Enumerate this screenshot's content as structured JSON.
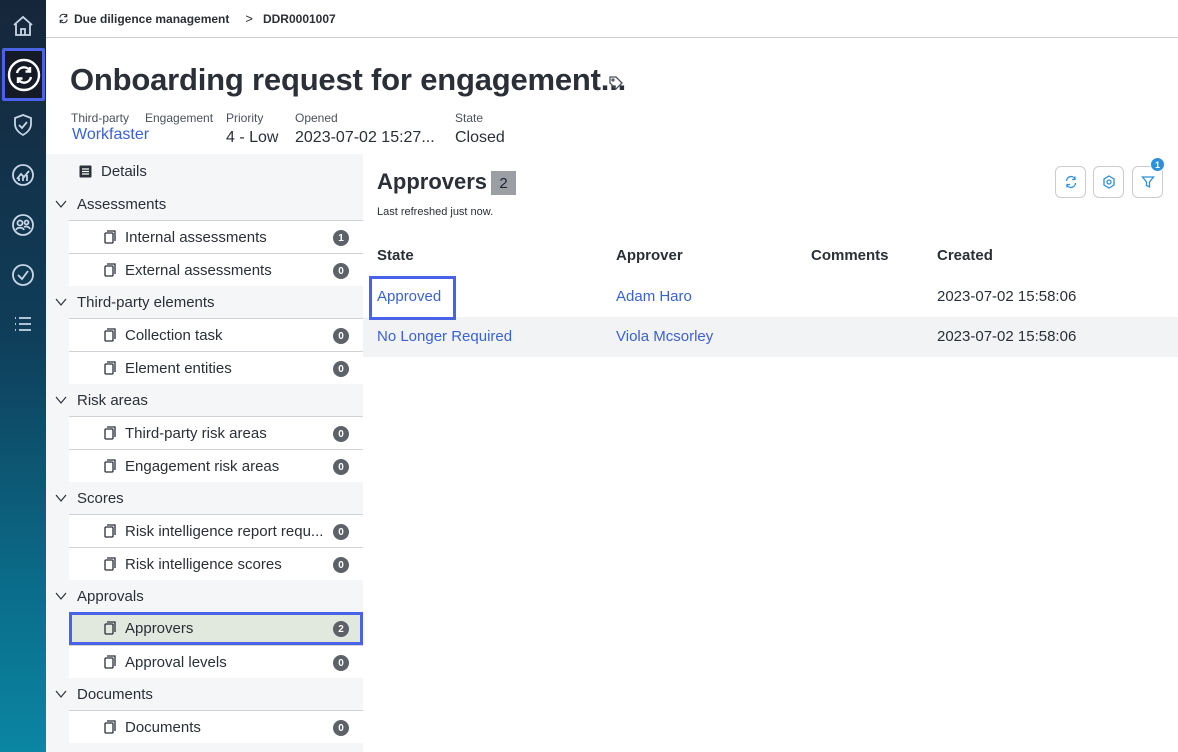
{
  "breadcrumb": {
    "module": "Due diligence management",
    "separator": ">",
    "record": "DDR0001007"
  },
  "header": {
    "title": "Onboarding request for engagement...",
    "fields": [
      {
        "label": "Third-party",
        "value": "Workfaster",
        "is_link": true
      },
      {
        "label": "Engagement",
        "value": ""
      },
      {
        "label": "Priority",
        "value": "4 - Low"
      },
      {
        "label": "Opened",
        "value": "2023-07-02 15:27..."
      },
      {
        "label": "State",
        "value": "Closed"
      }
    ]
  },
  "rail": {
    "items": [
      "home-icon",
      "sync-icon",
      "shield-check-icon",
      "analytics-icon",
      "people-icon",
      "check-circle-icon",
      "list-icon"
    ],
    "active": "sync-icon"
  },
  "tree": {
    "details_label": "Details",
    "groups": [
      {
        "label": "Assessments",
        "items": [
          {
            "label": "Internal assessments",
            "count": "1"
          },
          {
            "label": "External assessments",
            "count": "0"
          }
        ]
      },
      {
        "label": "Third-party elements",
        "items": [
          {
            "label": "Collection task",
            "count": "0"
          },
          {
            "label": "Element entities",
            "count": "0"
          }
        ]
      },
      {
        "label": "Risk areas",
        "items": [
          {
            "label": "Third-party risk areas",
            "count": "0"
          },
          {
            "label": "Engagement risk areas",
            "count": "0"
          }
        ]
      },
      {
        "label": "Scores",
        "items": [
          {
            "label": "Risk intelligence report requ...",
            "count": "0"
          },
          {
            "label": "Risk intelligence scores",
            "count": "0"
          }
        ]
      },
      {
        "label": "Approvals",
        "items": [
          {
            "label": "Approvers",
            "count": "2",
            "selected": true
          },
          {
            "label": "Approval levels",
            "count": "0"
          }
        ]
      },
      {
        "label": "Documents",
        "items": [
          {
            "label": "Documents",
            "count": "0"
          }
        ]
      }
    ]
  },
  "panel": {
    "title": "Approvers",
    "count": "2",
    "refresh_note": "Last refreshed just now.",
    "filter_count": "1",
    "columns": [
      "State",
      "Approver",
      "Comments",
      "Created"
    ],
    "rows": [
      {
        "state": "Approved",
        "approver": "Adam Haro",
        "comments": "",
        "created": "2023-07-02 15:58:06"
      },
      {
        "state": "No Longer Required",
        "approver": "Viola Mcsorley",
        "comments": "",
        "created": "2023-07-02 15:58:06"
      }
    ]
  },
  "colors": {
    "accent_outline": "#4a63e6",
    "link": "#3a62d6",
    "selected_row": "#e1e8dd",
    "badge": "#5d6168",
    "filter_badge": "#2f8fd8"
  }
}
